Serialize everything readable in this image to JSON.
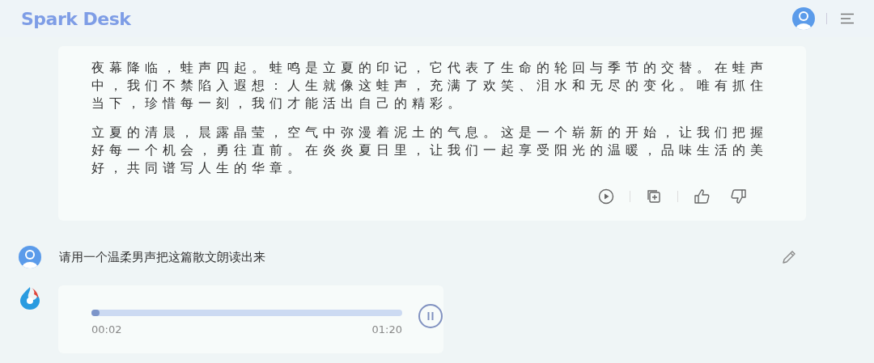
{
  "header": {
    "logo": "Spark Desk"
  },
  "answer": {
    "paragraphs": [
      "夜幕降临，蛙声四起。蛙鸣是立夏的印记，它代表了生命的轮回与季节的交替。在蛙声中，我们不禁陷入遐想：人生就像这蛙声，充满了欢笑、泪水和无尽的变化。唯有抓住当下，珍惜每一刻，我们才能活出自己的精彩。",
      "立夏的清晨，晨露晶莹，空气中弥漫着泥土的气息。这是一个崭新的开始，让我们把握好每一个机会，勇往直前。在炎炎夏日里，让我们一起享受阳光的温暖，品味生活的美好，共同谱写人生的华章。"
    ]
  },
  "question": {
    "text": "请用一个温柔男声把这篇散文朗读出来"
  },
  "audio": {
    "level": 0.025,
    "elapsed": "00:02",
    "duration": "01:20",
    "playing": true
  }
}
